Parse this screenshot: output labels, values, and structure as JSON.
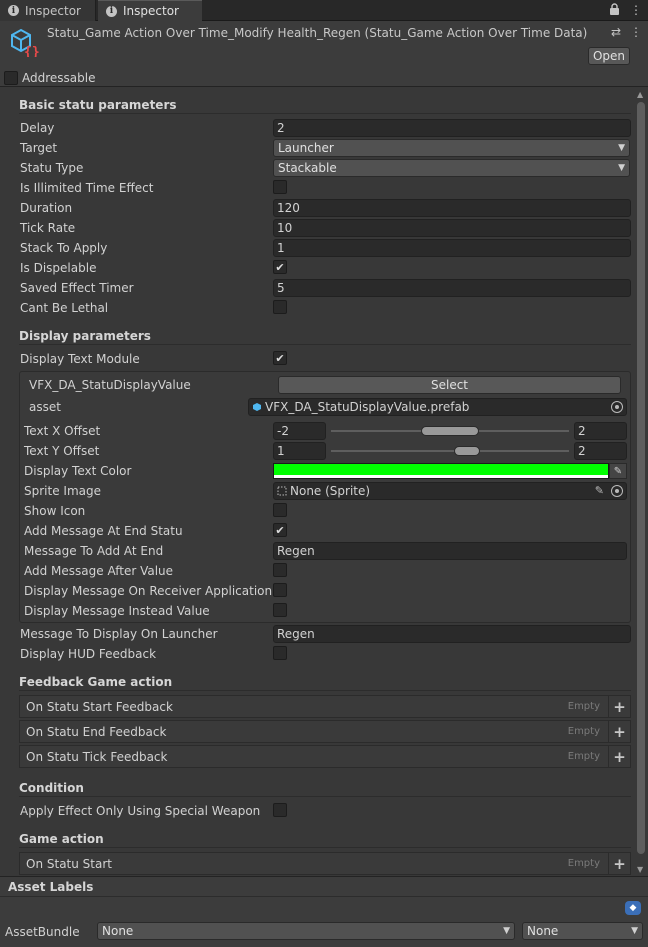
{
  "tabs": [
    {
      "label": "Inspector"
    },
    {
      "label": "Inspector"
    }
  ],
  "header": {
    "title": "Statu_Game Action Over Time_Modify Health_Regen (Statu_Game Action Over Time Data)",
    "open_label": "Open",
    "addressable_label": "Addressable",
    "addressable_checked": false
  },
  "basic": {
    "title": "Basic statu parameters",
    "delay": {
      "label": "Delay",
      "value": "2"
    },
    "target": {
      "label": "Target",
      "value": "Launcher"
    },
    "statu_type": {
      "label": "Statu Type",
      "value": "Stackable"
    },
    "illimited": {
      "label": "Is Illimited Time Effect",
      "checked": false
    },
    "duration": {
      "label": "Duration",
      "value": "120"
    },
    "tick_rate": {
      "label": "Tick Rate",
      "value": "10"
    },
    "stack": {
      "label": "Stack To Apply",
      "value": "1"
    },
    "dispelable": {
      "label": "Is Dispelable",
      "checked": true
    },
    "saved_timer": {
      "label": "Saved Effect Timer",
      "value": "5"
    },
    "lethal": {
      "label": "Cant Be Lethal",
      "checked": false
    }
  },
  "display": {
    "title": "Display parameters",
    "text_module": {
      "label": "Display Text Module",
      "checked": true
    },
    "vfx": {
      "label": "VFX_DA_StatuDisplayValue",
      "button": "Select"
    },
    "asset": {
      "label": "asset",
      "value": "VFX_DA_StatuDisplayValue.prefab"
    },
    "x_offset": {
      "label": "Text X Offset",
      "min": "-2",
      "max": "2"
    },
    "y_offset": {
      "label": "Text Y Offset",
      "min": "1",
      "max": "2"
    },
    "text_color": {
      "label": "Display Text Color",
      "color": "#00ff00"
    },
    "sprite": {
      "label": "Sprite Image",
      "value": "None (Sprite)"
    },
    "show_icon": {
      "label": "Show Icon",
      "checked": false
    },
    "msg_end": {
      "label": "Add Message At End Statu",
      "checked": true
    },
    "msg_end_text": {
      "label": "Message To Add At End",
      "value": "Regen"
    },
    "msg_after": {
      "label": "Add Message After Value",
      "checked": false
    },
    "msg_receiver": {
      "label": "Display Message On Receiver Application",
      "checked": false
    },
    "msg_instead": {
      "label": "Display Message Instead Value",
      "checked": false
    },
    "msg_launcher": {
      "label": "Message To Display On Launcher",
      "value": "Regen"
    },
    "hud": {
      "label": "Display HUD Feedback",
      "checked": false
    }
  },
  "feedback": {
    "title": "Feedback Game action",
    "empty": "Empty",
    "events": [
      {
        "label": "On Statu Start Feedback"
      },
      {
        "label": "On Statu End Feedback"
      },
      {
        "label": "On Statu Tick Feedback"
      }
    ]
  },
  "condition": {
    "title": "Condition",
    "special_weapon": {
      "label": "Apply Effect Only Using Special Weapon",
      "checked": false
    }
  },
  "game_action": {
    "title": "Game action",
    "events": [
      {
        "label": "On Statu Start"
      }
    ]
  },
  "asset_labels": {
    "title": "Asset Labels",
    "bundle_label": "AssetBundle",
    "bundle_value": "None",
    "variant_value": "None"
  },
  "colors": {
    "accent": "#3b6fb8",
    "text_color_swatch": "#00ff00"
  },
  "icons": {
    "tab": "info-icon",
    "lock": "lock-icon",
    "menu": "more-options-icon",
    "asset": "scriptable-object-icon",
    "presets": "presets-icon",
    "check": "checkmark-icon",
    "add": "plus-icon",
    "eyedropper": "eyedropper-icon",
    "pencil": "pencil-icon",
    "picker": "object-picker-icon",
    "tag": "label-tag-icon"
  }
}
